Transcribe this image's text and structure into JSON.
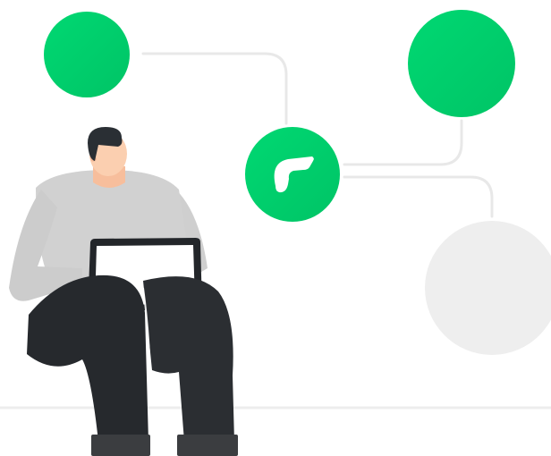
{
  "illustration": {
    "subject": "person-with-laptop-connected-nodes",
    "icons": [
      "brand-logo-icon"
    ],
    "colors": {
      "accent_green": "#00D16F",
      "accent_green_dark": "#00BE63",
      "placeholder_gray": "#EEEEEE",
      "connector_gray": "#E8E8E8",
      "skin": "#FBCFB0",
      "hair": "#2A2F34",
      "sweater": "#CFCFCF",
      "pants": "#26292D",
      "shoes": "#3B3D40",
      "laptop_frame": "#23262A",
      "laptop_screen": "#FFFFFF"
    }
  }
}
